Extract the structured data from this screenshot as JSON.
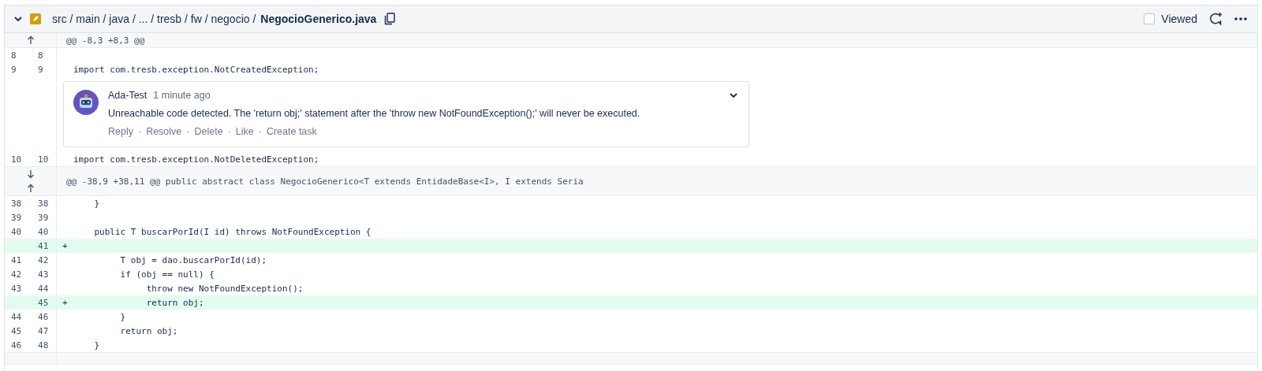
{
  "file_header": {
    "expanded": true,
    "path": "src / main / java / ... / tresb / fw / negocio /",
    "filename": "NegocioGenerico.java",
    "viewed": {
      "label": "Viewed",
      "checked": false
    }
  },
  "hunks": [
    {
      "header": "@@ -8,3 +8,3 @@",
      "expand_up": true,
      "lines": [
        {
          "kind": "context",
          "old": "8",
          "new": "8"
        },
        {
          "kind": "context",
          "old": "9",
          "new": "9",
          "code": "import com.tresb.exception.NotCreatedException;",
          "comment": {
            "author": "Ada-Test",
            "time": "1 minute ago",
            "text": "Unreachable code detected. The 'return obj;' statement after the 'throw new NotFoundException();' will never be executed.",
            "separator": "·",
            "actions": [
              "Reply",
              "Resolve",
              "Delete",
              "Like",
              "Create task"
            ]
          }
        },
        {
          "kind": "context",
          "old": "10",
          "new": "10",
          "code": "import com.tresb.exception.NotDeletedException;"
        }
      ]
    },
    {
      "header": "@@ -38,9 +38,11 @@ public abstract class NegocioGenerico<T extends EntidadeBase<I>, I extends Seria",
      "expand_up": true,
      "expand_down": true,
      "lines": [
        {
          "kind": "context",
          "old": "38",
          "new": "38",
          "code": "    }"
        },
        {
          "kind": "context",
          "old": "39",
          "new": "39"
        },
        {
          "kind": "context",
          "old": "40",
          "new": "40",
          "code": "    public T buscarPorId(I id) throws NotFoundException {"
        },
        {
          "kind": "add",
          "new": "41",
          "sign": "+"
        },
        {
          "kind": "context",
          "old": "41",
          "new": "42",
          "code": "         T obj = dao.buscarPorId(id);"
        },
        {
          "kind": "context",
          "old": "42",
          "new": "43",
          "code": "         if (obj == null) {"
        },
        {
          "kind": "context",
          "old": "43",
          "new": "44",
          "code": "              throw new NotFoundException();"
        },
        {
          "kind": "add",
          "new": "45",
          "sign": "+",
          "code": "              return obj;"
        },
        {
          "kind": "context",
          "old": "44",
          "new": "46",
          "code": "         }"
        },
        {
          "kind": "context",
          "old": "45",
          "new": "47",
          "code": "         return obj;"
        },
        {
          "kind": "context",
          "old": "46",
          "new": "48",
          "code": "    }"
        }
      ]
    }
  ]
}
